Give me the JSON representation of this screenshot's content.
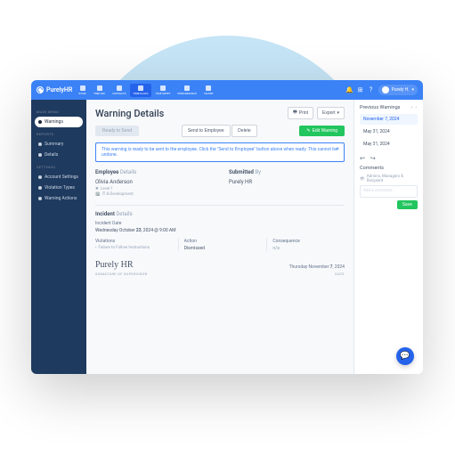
{
  "brand": "PurelyHR",
  "topnav": [
    "STAFF",
    "TIME-OFF",
    "CONTACTS",
    "TIME-CLOCK",
    "TIME SHEET",
    "PERFORMANCE",
    "TALENT"
  ],
  "topnav_active": 3,
  "user": "Purely H.",
  "sidebar": {
    "sections": [
      {
        "title": "MAIN MENU",
        "items": [
          {
            "label": "Warnings",
            "active": true
          }
        ]
      },
      {
        "title": "REPORTS",
        "items": [
          {
            "label": "Summary"
          },
          {
            "label": "Details"
          }
        ]
      },
      {
        "title": "SETTINGS",
        "items": [
          {
            "label": "Account Settings"
          },
          {
            "label": "Violation Types"
          },
          {
            "label": "Warning Actions"
          }
        ]
      }
    ]
  },
  "page": {
    "title": "Warning Details",
    "print": "Print",
    "export": "Export"
  },
  "actions": {
    "ready": "Ready to Send",
    "send": "Send to Employee",
    "delete": "Delete",
    "edit": "Edit Warning"
  },
  "alert": "This warning is ready to be sent to the employee. Click the \"Send to Employee\" button above when ready. This cannot be undone.",
  "employee": {
    "title": "Employee",
    "title_sub": "Details",
    "name": "Olivia Anderson",
    "level": "Level 1",
    "dept": "IT & Development"
  },
  "submitted": {
    "title": "Submitted",
    "title_sub": "By",
    "name": "Purely HR"
  },
  "incident": {
    "title": "Incident",
    "title_sub": "Details",
    "date_label": "Incident Date",
    "date_prefix": "Wednesday October",
    "date_day": "23",
    "date_suffix": ", 2024 @ 9:00 AM",
    "violations_label": "Violations",
    "violation": "Failure to Follow Instructions",
    "action_label": "Action",
    "action": "Dismissed",
    "consequence_label": "Consequence",
    "consequence": "n/a"
  },
  "signature": {
    "name": "Purely HR",
    "date_prefix": "Thursday November",
    "date_day": "7",
    "date_suffix": ", 2024",
    "label": "SIGNATURE OF SUPERVISOR",
    "date_label": "DATE"
  },
  "right": {
    "title": "Previous Warnings",
    "items": [
      {
        "date": "November 7, 2024",
        "active": true
      },
      {
        "date": "May 31, 2024"
      },
      {
        "date": "May 31, 2024"
      }
    ],
    "comments_title": "Comments",
    "visibility": "Admins, Managers & Recipient",
    "placeholder": "Add a comment...",
    "save": "Save"
  }
}
